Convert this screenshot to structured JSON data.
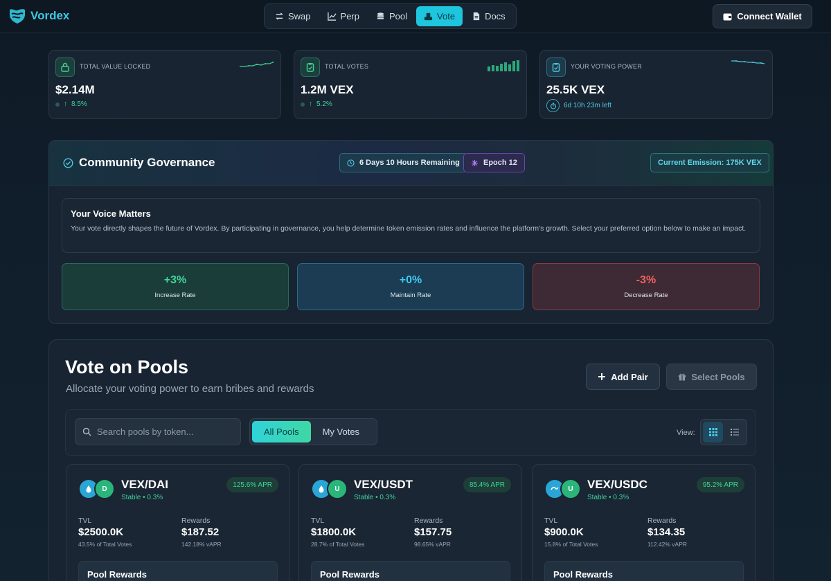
{
  "brand": {
    "name": "Vordex",
    "color": "#3fc7e0"
  },
  "nav": {
    "items": [
      {
        "label": "Swap",
        "icon": "swap-icon"
      },
      {
        "label": "Perp",
        "icon": "chart-icon"
      },
      {
        "label": "Pool",
        "icon": "coins-icon"
      },
      {
        "label": "Vote",
        "icon": "ballot-icon",
        "active": true
      },
      {
        "label": "Docs",
        "icon": "doc-icon"
      }
    ],
    "connect_label": "Connect Wallet"
  },
  "stats": [
    {
      "label": "TOTAL VALUE LOCKED",
      "value": "$2.14M",
      "change": "8.5%",
      "icon": "lock-icon"
    },
    {
      "label": "TOTAL VOTES",
      "value": "1.2M VEX",
      "change": "5.2%",
      "icon": "clipboard-icon"
    },
    {
      "label": "YOUR VOTING POWER",
      "value": "25.5K VEX",
      "timer": "6d 10h 23m left",
      "icon": "clipboard-icon"
    }
  ],
  "governance": {
    "title": "Community Governance",
    "time_remaining": "6 Days 10 Hours Remaining",
    "epoch": "Epoch 12",
    "emission": "Current Emission: 175K VEX",
    "voice_title": "Your Voice Matters",
    "voice_text": "Your vote directly shapes the future of Vordex. By participating in governance, you help determine token emission rates and influence the platform's growth. Select your preferred option below to make an impact.",
    "options": [
      {
        "pct": "+3%",
        "label": "Increase Rate"
      },
      {
        "pct": "+0%",
        "label": "Maintain Rate"
      },
      {
        "pct": "-3%",
        "label": "Decrease Rate"
      }
    ]
  },
  "pools": {
    "title": "Vote on Pools",
    "subtitle": "Allocate your voting power to earn bribes and rewards",
    "add_pair": "Add Pair",
    "select_pools": "Select Pools",
    "search_placeholder": "Search pools by token...",
    "tabs": [
      "All Pools",
      "My Votes"
    ],
    "view_label": "View:",
    "tvl_label": "TVL",
    "rewards_label": "Rewards",
    "pool_rewards_label": "Pool Rewards",
    "cards": [
      {
        "pair": "VEX/DAI",
        "meta": "Stable • 0.3%",
        "apr": "125.6% APR",
        "tok2": "D",
        "tvl": "$2500.0K",
        "tvl_sub": "43.5% of Total Votes",
        "rewards": "$187.52",
        "rewards_sub": "142.18% vAPR"
      },
      {
        "pair": "VEX/USDT",
        "meta": "Stable • 0.3%",
        "apr": "85.4% APR",
        "tok2": "U",
        "tvl": "$1800.0K",
        "tvl_sub": "28.7% of Total Votes",
        "rewards": "$157.75",
        "rewards_sub": "98.65% vAPR"
      },
      {
        "pair": "VEX/USDC",
        "meta": "Stable • 0.3%",
        "apr": "95.2% APR",
        "tok2": "U",
        "tvl": "$900.0K",
        "tvl_sub": "15.8% of Total Votes",
        "rewards": "$134.35",
        "rewards_sub": "112.42% vAPR"
      }
    ]
  }
}
